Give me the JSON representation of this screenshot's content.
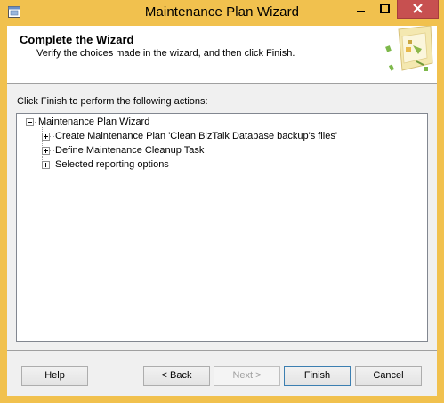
{
  "window": {
    "title": "Maintenance Plan Wizard"
  },
  "banner": {
    "title": "Complete the Wizard",
    "subtitle": "Verify the choices made in the wizard, and then click Finish."
  },
  "instruction": "Click Finish to perform the following actions:",
  "tree": {
    "root": "Maintenance Plan Wizard",
    "children": [
      "Create Maintenance Plan 'Clean BizTalk Database backup's files'",
      "Define Maintenance Cleanup Task",
      "Selected reporting options"
    ]
  },
  "buttons": {
    "help": "Help",
    "back": "< Back",
    "next": "Next >",
    "finish": "Finish",
    "cancel": "Cancel"
  },
  "colors": {
    "titlebar": "#f1c14e",
    "close_button": "#c75050"
  },
  "icons": [
    "app-icon",
    "minimize-icon",
    "maximize-icon",
    "close-icon",
    "wizard-graphic"
  ]
}
